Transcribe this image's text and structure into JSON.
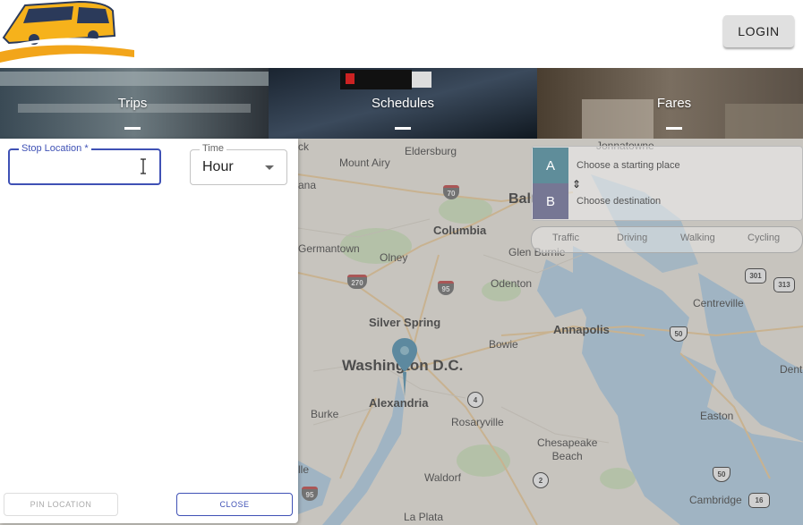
{
  "header": {
    "login_label": "LOGIN"
  },
  "nav": {
    "tabs": [
      {
        "label": "Trips"
      },
      {
        "label": "Schedules"
      },
      {
        "label": "Fares"
      }
    ]
  },
  "panel": {
    "stop_location": {
      "label": "Stop Location *",
      "value": ""
    },
    "time": {
      "label": "Time",
      "value": "Hour"
    },
    "pin_location_label": "PIN LOCATION",
    "close_label": "CLOSE"
  },
  "directions": {
    "a_label": "A",
    "b_label": "B",
    "start_placeholder": "Choose a starting place",
    "dest_placeholder": "Choose destination",
    "swap_glyph": "⇕",
    "modes": [
      "Traffic",
      "Driving",
      "Walking",
      "Cycling"
    ]
  },
  "map": {
    "places": {
      "mount_airy": "Mount Airy",
      "eldersburg": "Eldersburg",
      "balt": "Balt",
      "columbia": "Columbia",
      "glen_burnie": "Glen Burnie",
      "olney": "Olney",
      "germantown": "Germantown",
      "odenton": "Odenton",
      "centreville": "Centreville",
      "silver_spring": "Silver Spring",
      "annapolis": "Annapolis",
      "bowie": "Bowie",
      "washington": "Washington D.C.",
      "alexandria": "Alexandria",
      "burke": "Burke",
      "rosaryville": "Rosaryville",
      "easton": "Easton",
      "chesapeake_beach": "Chesapeake\nBeach",
      "waldorf": "Waldorf",
      "cambridge": "Cambridge",
      "la_plata": "La Plata",
      "dent": "Dent",
      "lle": "lle",
      "ck": "ck",
      "ana": "ana",
      "jonnatowne": "Jonnatowne"
    },
    "shields": {
      "i70": "70",
      "i270": "270",
      "i95a": "95",
      "i95b": "95",
      "s4": "4",
      "s2": "2",
      "us50a": "50",
      "us50b": "50",
      "s301": "301",
      "s313": "313",
      "s16": "16"
    }
  }
}
